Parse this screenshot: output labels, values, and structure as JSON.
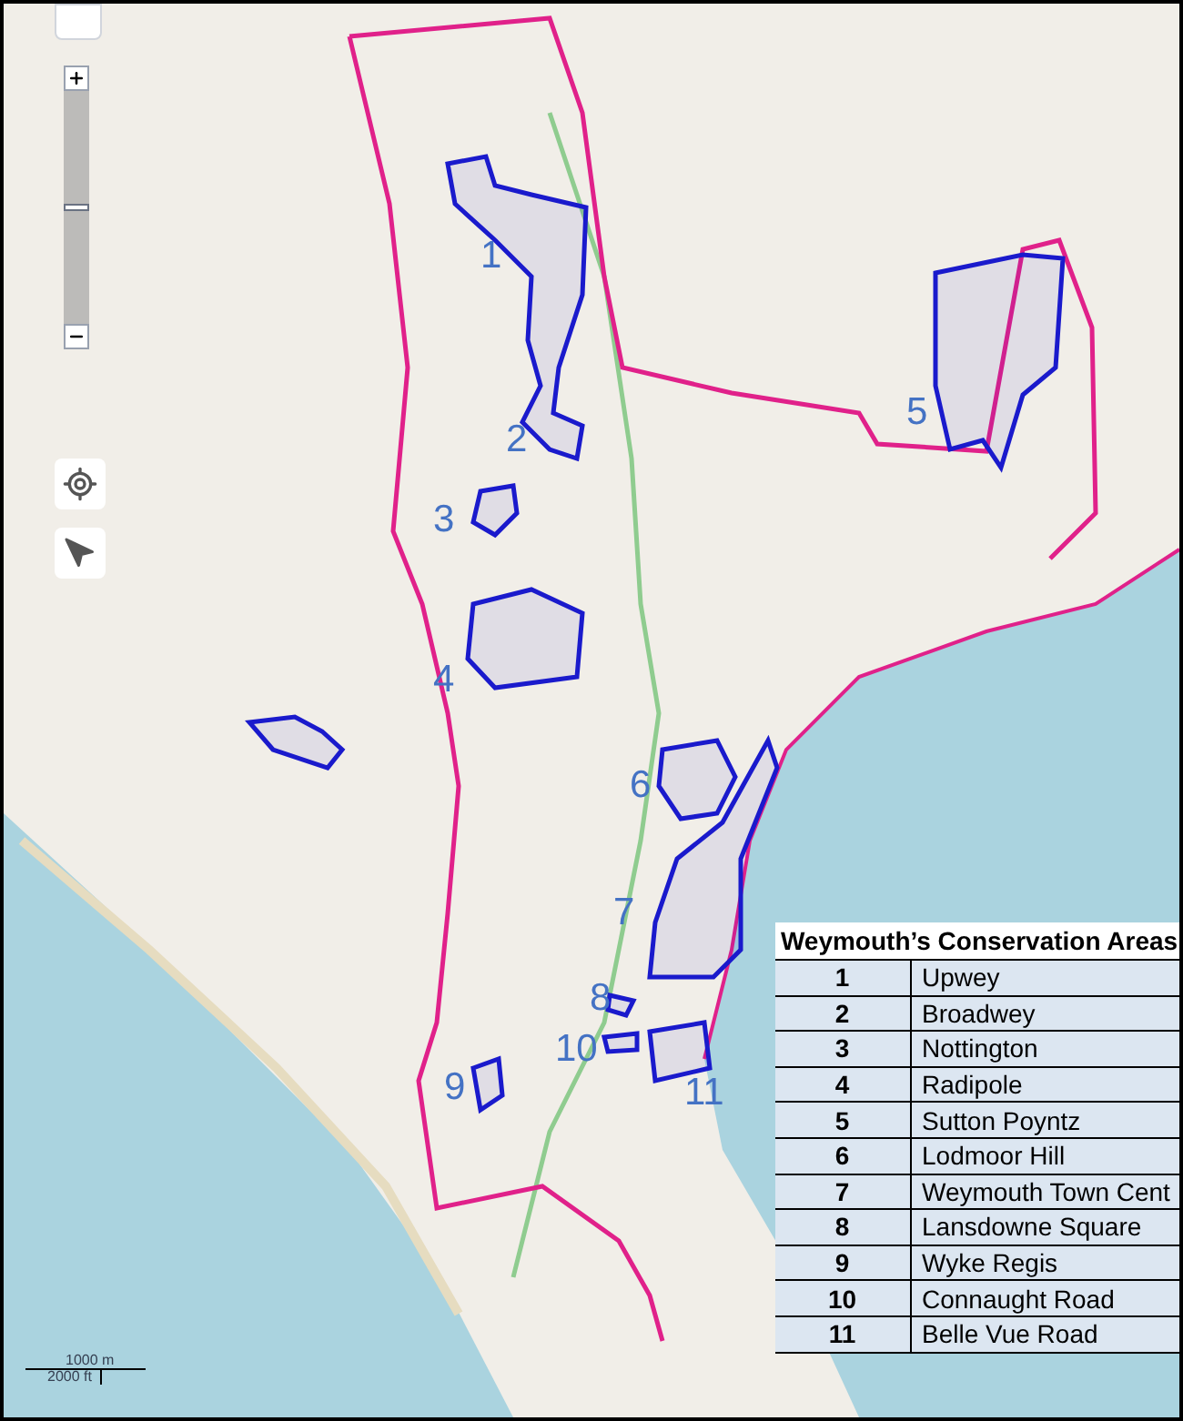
{
  "map": {
    "area_labels": [
      {
        "text": "1"
      },
      {
        "text": "2"
      },
      {
        "text": "3"
      },
      {
        "text": "4"
      },
      {
        "text": "5"
      },
      {
        "text": "6"
      },
      {
        "text": "7"
      },
      {
        "text": "8"
      },
      {
        "text": "9"
      },
      {
        "text": "10"
      },
      {
        "text": "11"
      }
    ],
    "scale": {
      "metric": "1000 m",
      "imperial": "2000 ft"
    }
  },
  "legend": {
    "title": "Weymouth’s Conservation Areas",
    "rows": [
      {
        "number": "1",
        "name": "Upwey"
      },
      {
        "number": "2",
        "name": "Broadwey"
      },
      {
        "number": "3",
        "name": "Nottington"
      },
      {
        "number": "4",
        "name": "Radipole"
      },
      {
        "number": "5",
        "name": "Sutton Poyntz"
      },
      {
        "number": "6",
        "name": "Lodmoor Hill"
      },
      {
        "number": "7",
        "name": "Weymouth Town Cent"
      },
      {
        "number": "8",
        "name": "Lansdowne Square"
      },
      {
        "number": "9",
        "name": "Wyke Regis"
      },
      {
        "number": "10",
        "name": "Connaught Road"
      },
      {
        "number": "11",
        "name": "Belle Vue Road"
      }
    ]
  }
}
